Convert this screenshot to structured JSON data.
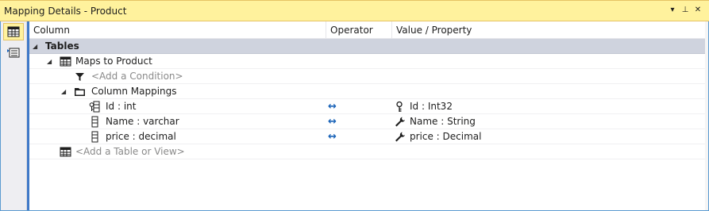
{
  "window": {
    "title": "Mapping Details - Product",
    "dropdown_glyph": "▾",
    "pin_glyph": "⊥",
    "close_glyph": "✕"
  },
  "columns": {
    "column": "Column",
    "operator": "Operator",
    "value": "Value / Property"
  },
  "tree": {
    "tables_label": "Tables",
    "maps_to": "Maps to Product",
    "add_condition": "<Add a Condition>",
    "column_mappings": "Column Mappings",
    "mappings": [
      {
        "column": "Id : int",
        "operator": "↔",
        "property": "Id : Int32",
        "column_icon": "key-column-icon",
        "property_icon": "key-property-icon"
      },
      {
        "column": "Name : varchar",
        "operator": "↔",
        "property": "Name : String",
        "column_icon": "column-icon",
        "property_icon": "wrench-property-icon"
      },
      {
        "column": "price : decimal",
        "operator": "↔",
        "property": "price : Decimal",
        "column_icon": "column-icon",
        "property_icon": "wrench-property-icon"
      }
    ],
    "add_table": "<Add a Table or View>"
  },
  "colors": {
    "title_bg": "#fff29d",
    "group_bg": "#cfd3de",
    "accent": "#3f79c8",
    "operator": "#1a63b8"
  }
}
